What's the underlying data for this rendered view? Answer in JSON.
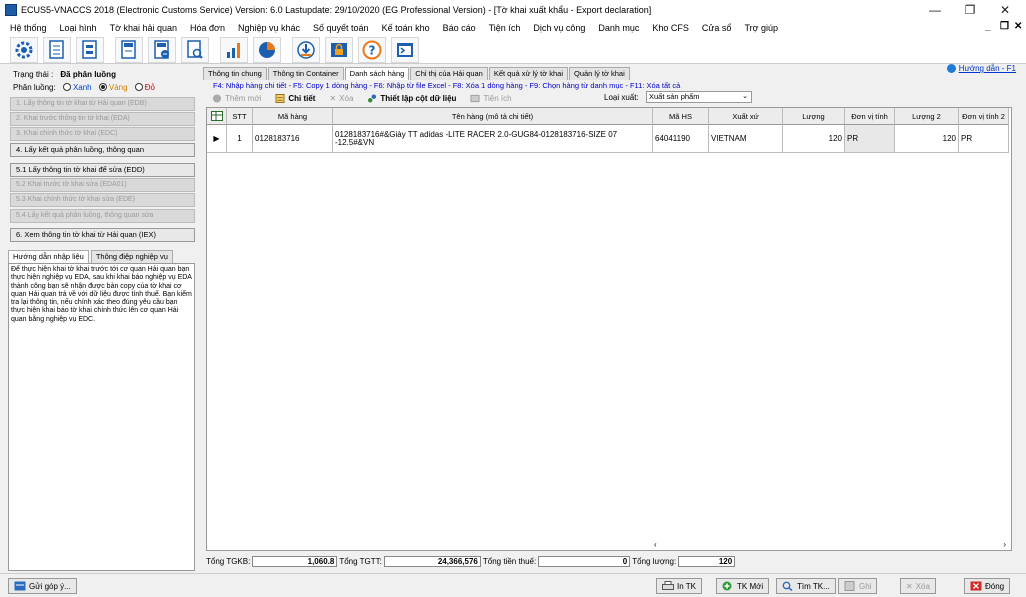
{
  "window": {
    "title": "ECUS5-VNACCS 2018 (Electronic Customs Service) Version: 6.0 Lastupdate: 29/10/2020 (EG Professional Version) - [Tờ khai xuất khẩu - Export declaration]",
    "min": "—",
    "max": "❐",
    "close": "✕"
  },
  "menu": [
    "Hệ thống",
    "Loại hình",
    "Tờ khai hải quan",
    "Hóa đơn",
    "Nghiệp vụ khác",
    "Số quyết toán",
    "Kế toán kho",
    "Báo cáo",
    "Tiện ích",
    "Dịch vụ công",
    "Danh mục",
    "Kho CFS",
    "Cửa sổ",
    "Trợ giúp"
  ],
  "mdi": {
    "min": "_",
    "restore": "❐",
    "close": "✕"
  },
  "toolbar_icons": [
    "gear-icon",
    "doc-icon",
    "doc-list-icon",
    "eda-icon",
    "eda-minus-icon",
    "search-doc-icon",
    "bar-chart-icon",
    "pie-chart-icon",
    "download-icon",
    "lock-icon",
    "help-icon",
    "terminal-icon"
  ],
  "left": {
    "status_label": "Trạng thái :",
    "status_value": "Đã phân luồng",
    "lane_label": "Phân luồng:",
    "lanes": [
      {
        "label": "Xanh",
        "selected": false
      },
      {
        "label": "Vàng",
        "selected": true
      },
      {
        "label": "Đỏ",
        "selected": false
      }
    ],
    "steps": [
      {
        "label": "1. Lấy thông tin tờ khai từ Hải quan (EDB)",
        "enabled": false
      },
      {
        "label": "2. Khai trước thông tin tờ khai (EDA)",
        "enabled": false
      },
      {
        "label": "3. Khai chính thức tờ khai (EDC)",
        "enabled": false
      },
      {
        "label": "4. Lấy kết quả phân luồng, thông quan",
        "enabled": true
      },
      {
        "label": "5.1 Lấy thông tin tờ khai để sửa (EDD)",
        "enabled": true
      },
      {
        "label": "5.2 Khai trước tờ khai sửa (EDA01)",
        "enabled": false
      },
      {
        "label": "5.3 Khai chính thức tờ khai sửa (EDE)",
        "enabled": false
      },
      {
        "label": "5.4 Lấy kết quả phân luồng, thông quan sửa",
        "enabled": false
      },
      {
        "label": "6. Xem thông tin tờ khai từ Hải quan (IEX)",
        "enabled": true
      }
    ],
    "tabs": [
      "Hướng dẫn nhập liệu",
      "Thông điệp nghiệp vụ"
    ],
    "guide": "Để thực hiện khai tờ khai trước tới cơ quan Hải quan bạn thực hiện nghiệp vụ EDA, sau khi khai báo nghiệp vụ EDA thành công bạn sẽ nhận được bản copy của tờ khai cơ quan Hải quan trả về với dữ liệu được tính thuế. Bạn kiểm tra lại thông tin, nếu chính xác theo đúng yêu cầu bạn thực hiện khai báo tờ khai chính thức lên cơ quan Hải quan bằng nghiệp vụ EDC."
  },
  "tabs": [
    "Thông tin chung",
    "Thông tin Container",
    "Danh sách hàng",
    "Chỉ thị của Hải quan",
    "Kết quả xử lý tờ khai",
    "Quản lý tờ khai"
  ],
  "active_tab": 2,
  "help_link": "Hướng dẫn - F1",
  "hotkeys": "F4: Nhập hàng chi tiết - F5: Copy 1 dòng hàng - F6: Nhập từ file Excel - F8: Xóa 1 dòng hàng - F9: Chọn hàng từ danh mục - F11: Xóa tất cả",
  "subtoolbar": {
    "add": "Thêm mới",
    "detail": "Chi tiết",
    "delete": "Xóa",
    "setup": "Thiết lập cột dữ liệu",
    "utility": "Tiện ích",
    "loai_label": "Loại xuất:",
    "loai_value": "Xuất sản phẩm"
  },
  "grid": {
    "headers": [
      "STT",
      "Mã hàng",
      "Tên hàng (mô tả chi tiết)",
      "Mã HS",
      "Xuất xứ",
      "Lượng",
      "Đơn vị tính",
      "Lượng 2",
      "Đơn vị tính 2"
    ],
    "rows": [
      {
        "stt": "1",
        "ma_hang": "0128183716",
        "ten_hang": "0128183716#&Giày TT adidas -LITE RACER 2.0-GUG84-0128183716-SIZE 07 -12.5#&VN",
        "ma_hs": "64041190",
        "xuat_xu": "VIETNAM",
        "luong": "120",
        "dvt": "PR",
        "luong2": "120",
        "dvt2": "PR"
      }
    ]
  },
  "totals": {
    "tgkb_label": "Tổng TGKB:",
    "tgkb": "1,060.8",
    "tgtt_label": "Tổng TGTT:",
    "tgtt": "24,366,576",
    "thue_label": "Tổng tiền thuế:",
    "thue": "0",
    "luong_label": "Tổng lượng:",
    "luong": "120"
  },
  "bottom": {
    "feedback": "Gửi góp ý...",
    "print": "In TK",
    "new": "TK Mới",
    "find": "Tìm TK...",
    "save": "Ghi",
    "delete": "Xóa",
    "close": "Đóng"
  }
}
